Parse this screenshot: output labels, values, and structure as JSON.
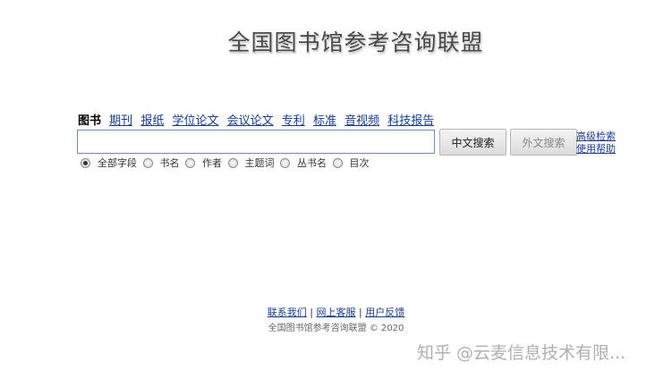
{
  "header": {
    "title": "全国图书馆参考咨询联盟"
  },
  "tabs": [
    {
      "label": "图书",
      "active": true
    },
    {
      "label": "期刊",
      "active": false
    },
    {
      "label": "报纸",
      "active": false
    },
    {
      "label": "学位论文",
      "active": false
    },
    {
      "label": "会议论文",
      "active": false
    },
    {
      "label": "专利",
      "active": false
    },
    {
      "label": "标准",
      "active": false
    },
    {
      "label": "音视频",
      "active": false
    },
    {
      "label": "科技报告",
      "active": false
    }
  ],
  "search": {
    "value": "",
    "placeholder": "",
    "cn_button": "中文搜索",
    "foreign_button": "外文搜索",
    "advanced_link": "高级检索",
    "help_link": "使用帮助"
  },
  "fields": [
    {
      "label": "全部字段",
      "checked": true
    },
    {
      "label": "书名",
      "checked": false
    },
    {
      "label": "作者",
      "checked": false
    },
    {
      "label": "主题词",
      "checked": false
    },
    {
      "label": "丛书名",
      "checked": false
    },
    {
      "label": "目次",
      "checked": false
    }
  ],
  "footer": {
    "contact": "联系我们",
    "service": "网上客服",
    "feedback": "用户反馈",
    "separator": "|",
    "copyright": "全国图书馆参考咨询联盟 © 2020"
  },
  "watermark": "知乎 @云麦信息技术有限..."
}
